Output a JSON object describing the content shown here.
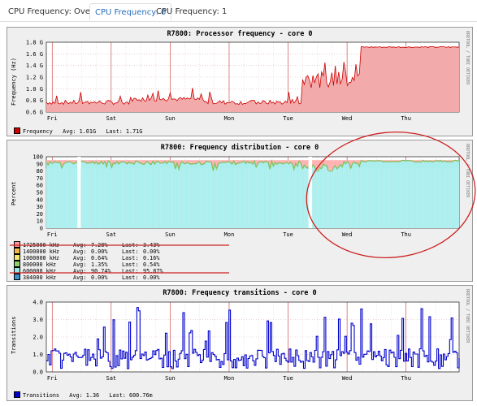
{
  "tabs": [
    {
      "label": "CPU Frequency: Overview"
    },
    {
      "label": "CPU Frequency: 0"
    },
    {
      "label": "CPU Frequency: 1"
    }
  ],
  "side_text": "RRDTOOL / TOBI OETIKER",
  "colors": {
    "accent": "#2a6ebb",
    "annotation": "#cc2222",
    "freq_line": "#cc0000",
    "freq_fill": "#f2aaaa",
    "transitions": "#0000cc"
  },
  "charts": {
    "freq": {
      "title": "R7800: Processor frequency - core 0",
      "ylabel": "Frequency (Hz)",
      "ticks": [
        "0.6 G",
        "0.8 G",
        "1.0 G",
        "1.2 G",
        "1.4 G",
        "1.6 G",
        "1.8 G"
      ],
      "days": [
        "Fri",
        "Sat",
        "Sun",
        "Mon",
        "Tue",
        "Wed",
        "Thu"
      ],
      "legend": {
        "label": "Frequency",
        "avg_label": "Avg:",
        "avg": "1.01G",
        "last_label": "Last:",
        "last": "1.71G"
      }
    },
    "dist": {
      "title": "R7800: Frequency distribution - core 0",
      "ylabel": "Percent",
      "ticks": [
        "0",
        "10",
        "20",
        "30",
        "40",
        "50",
        "60",
        "70",
        "80",
        "90",
        "100"
      ],
      "days": [
        "Fri",
        "Sat",
        "Sun",
        "Mon",
        "Tue",
        "Wed",
        "Thu"
      ],
      "legend": [
        {
          "label": "1725000 kHz",
          "avg_label": "Avg:",
          "avg": "7.28%",
          "last_label": "Last:",
          "last": "3.43%",
          "color": "#ff9999"
        },
        {
          "label": "1400000 kHz",
          "avg_label": "Avg:",
          "avg": "0.00%",
          "last_label": "Last:",
          "last": "0.00%",
          "color": "#f0b84a"
        },
        {
          "label": "1000000 kHz",
          "avg_label": "Avg:",
          "avg": "0.64%",
          "last_label": "Last:",
          "last": "0.16%",
          "color": "#f3e96e"
        },
        {
          "label": "800000 kHz",
          "avg_label": "Avg:",
          "avg": "1.35%",
          "last_label": "Last:",
          "last": "0.54%",
          "color": "#8fd06a"
        },
        {
          "label": "600000 kHz",
          "avg_label": "Avg:",
          "avg": "90.74%",
          "last_label": "Last:",
          "last": "95.87%",
          "color": "#99e6e6"
        },
        {
          "label": "384000 kHz",
          "avg_label": "Avg:",
          "avg": "0.00%",
          "last_label": "Last:",
          "last": "0.00%",
          "color": "#3d8ec9"
        }
      ]
    },
    "trans": {
      "title": "R7800: Frequency transitions - core 0",
      "ylabel": "Transitions",
      "ticks": [
        "0.0",
        "1.0",
        "2.0",
        "3.0",
        "4.0"
      ],
      "days": [
        "Fri",
        "Sat",
        "Sun",
        "Mon",
        "Tue",
        "Wed",
        "Thu"
      ],
      "legend": {
        "label": "Transitions",
        "avg_label": "Avg:",
        "avg": "1.36",
        "last_label": "Last:",
        "last": "600.76m"
      }
    }
  }
}
